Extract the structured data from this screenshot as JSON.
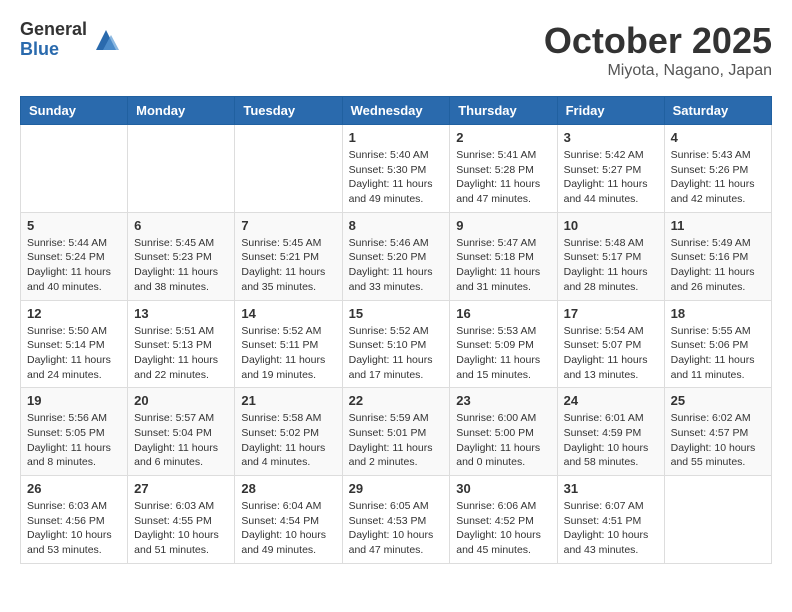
{
  "header": {
    "logo_general": "General",
    "logo_blue": "Blue",
    "month_title": "October 2025",
    "location": "Miyota, Nagano, Japan"
  },
  "weekdays": [
    "Sunday",
    "Monday",
    "Tuesday",
    "Wednesday",
    "Thursday",
    "Friday",
    "Saturday"
  ],
  "weeks": [
    [
      {
        "day": "",
        "info": ""
      },
      {
        "day": "",
        "info": ""
      },
      {
        "day": "",
        "info": ""
      },
      {
        "day": "1",
        "info": "Sunrise: 5:40 AM\nSunset: 5:30 PM\nDaylight: 11 hours and 49 minutes."
      },
      {
        "day": "2",
        "info": "Sunrise: 5:41 AM\nSunset: 5:28 PM\nDaylight: 11 hours and 47 minutes."
      },
      {
        "day": "3",
        "info": "Sunrise: 5:42 AM\nSunset: 5:27 PM\nDaylight: 11 hours and 44 minutes."
      },
      {
        "day": "4",
        "info": "Sunrise: 5:43 AM\nSunset: 5:26 PM\nDaylight: 11 hours and 42 minutes."
      }
    ],
    [
      {
        "day": "5",
        "info": "Sunrise: 5:44 AM\nSunset: 5:24 PM\nDaylight: 11 hours and 40 minutes."
      },
      {
        "day": "6",
        "info": "Sunrise: 5:45 AM\nSunset: 5:23 PM\nDaylight: 11 hours and 38 minutes."
      },
      {
        "day": "7",
        "info": "Sunrise: 5:45 AM\nSunset: 5:21 PM\nDaylight: 11 hours and 35 minutes."
      },
      {
        "day": "8",
        "info": "Sunrise: 5:46 AM\nSunset: 5:20 PM\nDaylight: 11 hours and 33 minutes."
      },
      {
        "day": "9",
        "info": "Sunrise: 5:47 AM\nSunset: 5:18 PM\nDaylight: 11 hours and 31 minutes."
      },
      {
        "day": "10",
        "info": "Sunrise: 5:48 AM\nSunset: 5:17 PM\nDaylight: 11 hours and 28 minutes."
      },
      {
        "day": "11",
        "info": "Sunrise: 5:49 AM\nSunset: 5:16 PM\nDaylight: 11 hours and 26 minutes."
      }
    ],
    [
      {
        "day": "12",
        "info": "Sunrise: 5:50 AM\nSunset: 5:14 PM\nDaylight: 11 hours and 24 minutes."
      },
      {
        "day": "13",
        "info": "Sunrise: 5:51 AM\nSunset: 5:13 PM\nDaylight: 11 hours and 22 minutes."
      },
      {
        "day": "14",
        "info": "Sunrise: 5:52 AM\nSunset: 5:11 PM\nDaylight: 11 hours and 19 minutes."
      },
      {
        "day": "15",
        "info": "Sunrise: 5:52 AM\nSunset: 5:10 PM\nDaylight: 11 hours and 17 minutes."
      },
      {
        "day": "16",
        "info": "Sunrise: 5:53 AM\nSunset: 5:09 PM\nDaylight: 11 hours and 15 minutes."
      },
      {
        "day": "17",
        "info": "Sunrise: 5:54 AM\nSunset: 5:07 PM\nDaylight: 11 hours and 13 minutes."
      },
      {
        "day": "18",
        "info": "Sunrise: 5:55 AM\nSunset: 5:06 PM\nDaylight: 11 hours and 11 minutes."
      }
    ],
    [
      {
        "day": "19",
        "info": "Sunrise: 5:56 AM\nSunset: 5:05 PM\nDaylight: 11 hours and 8 minutes."
      },
      {
        "day": "20",
        "info": "Sunrise: 5:57 AM\nSunset: 5:04 PM\nDaylight: 11 hours and 6 minutes."
      },
      {
        "day": "21",
        "info": "Sunrise: 5:58 AM\nSunset: 5:02 PM\nDaylight: 11 hours and 4 minutes."
      },
      {
        "day": "22",
        "info": "Sunrise: 5:59 AM\nSunset: 5:01 PM\nDaylight: 11 hours and 2 minutes."
      },
      {
        "day": "23",
        "info": "Sunrise: 6:00 AM\nSunset: 5:00 PM\nDaylight: 11 hours and 0 minutes."
      },
      {
        "day": "24",
        "info": "Sunrise: 6:01 AM\nSunset: 4:59 PM\nDaylight: 10 hours and 58 minutes."
      },
      {
        "day": "25",
        "info": "Sunrise: 6:02 AM\nSunset: 4:57 PM\nDaylight: 10 hours and 55 minutes."
      }
    ],
    [
      {
        "day": "26",
        "info": "Sunrise: 6:03 AM\nSunset: 4:56 PM\nDaylight: 10 hours and 53 minutes."
      },
      {
        "day": "27",
        "info": "Sunrise: 6:03 AM\nSunset: 4:55 PM\nDaylight: 10 hours and 51 minutes."
      },
      {
        "day": "28",
        "info": "Sunrise: 6:04 AM\nSunset: 4:54 PM\nDaylight: 10 hours and 49 minutes."
      },
      {
        "day": "29",
        "info": "Sunrise: 6:05 AM\nSunset: 4:53 PM\nDaylight: 10 hours and 47 minutes."
      },
      {
        "day": "30",
        "info": "Sunrise: 6:06 AM\nSunset: 4:52 PM\nDaylight: 10 hours and 45 minutes."
      },
      {
        "day": "31",
        "info": "Sunrise: 6:07 AM\nSunset: 4:51 PM\nDaylight: 10 hours and 43 minutes."
      },
      {
        "day": "",
        "info": ""
      }
    ]
  ]
}
